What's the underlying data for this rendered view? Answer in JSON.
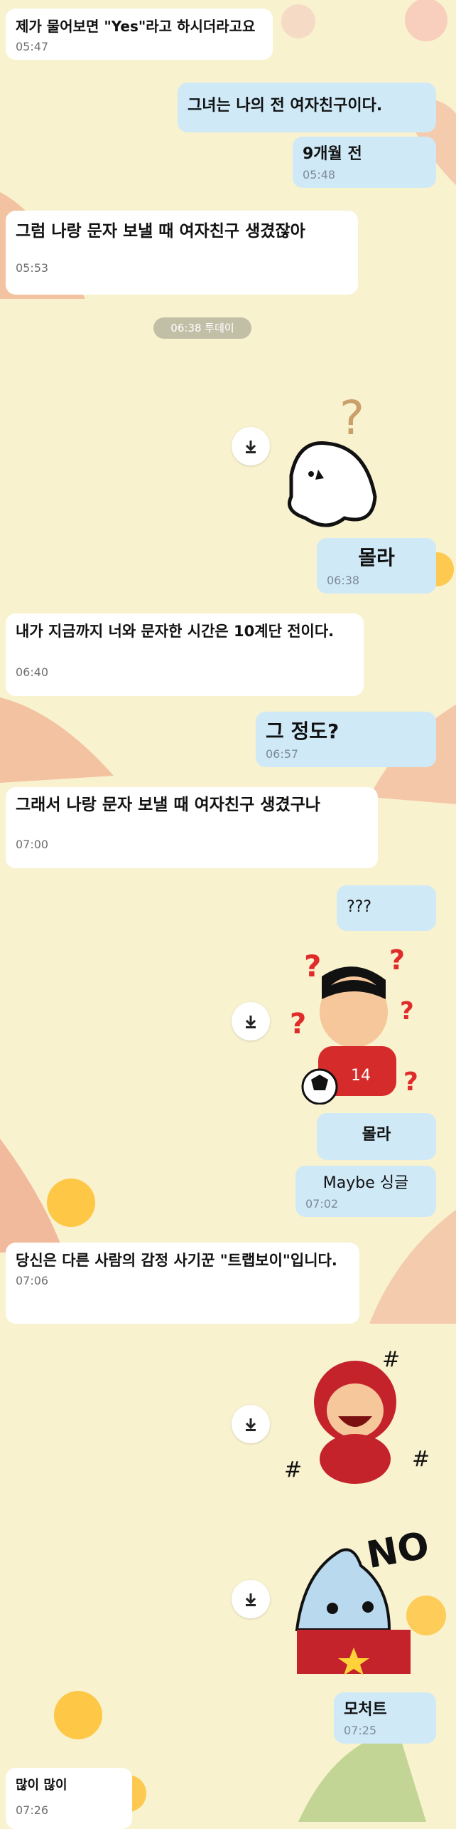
{
  "messages": [
    {
      "text": "제가 물어보면 \"Yes\"라고 하시더라고요",
      "time": "05:47",
      "side": "in"
    },
    {
      "text": "그녀는 나의 전 여자친구이다.",
      "time": "",
      "side": "out"
    },
    {
      "text": "9개월 전",
      "time": "05:48",
      "side": "out"
    },
    {
      "text": "그럼 나랑 문자 보낼 때 여자친구 생겼잖아",
      "time": "05:53",
      "side": "in"
    },
    {
      "text": "몰라",
      "time": "06:38",
      "side": "out"
    },
    {
      "text": "내가 지금까지 너와 문자한 시간은 10계단 전이다.",
      "time": "06:40",
      "side": "in"
    },
    {
      "text": "그 정도?",
      "time": "06:57",
      "side": "out"
    },
    {
      "text": "그래서 나랑 문자 보낼 때 여자친구 생겼구나",
      "time": "07:00",
      "side": "in"
    },
    {
      "text": "???",
      "time": "",
      "side": "out"
    },
    {
      "text": "몰라",
      "time": "",
      "side": "out"
    },
    {
      "text": "Maybe 싱글",
      "time": "07:02",
      "side": "out"
    },
    {
      "text": "당신은 다른 사람의 감정 사기꾼 \"트랩보이\"입니다.",
      "time": "07:06",
      "side": "in"
    },
    {
      "text": "모처트",
      "time": "07:25",
      "side": "out"
    },
    {
      "text": "많이 많이",
      "time": "07:26",
      "side": "in"
    }
  ],
  "date_divider": "06:38 투데이",
  "stickers": [
    {
      "name": "ghost-sticker",
      "icon": "ghost-with-question-mark"
    },
    {
      "name": "boy-sticker",
      "icon": "confused-boy-football-14",
      "jersey": "14"
    },
    {
      "name": "laughing-sticker",
      "icon": "laughing-red-hood-character"
    },
    {
      "name": "shark-sticker",
      "icon": "shark-no",
      "caption": "NO"
    }
  ],
  "colors": {
    "background": "#f8f2cf",
    "incoming_bubble": "#ffffff",
    "outgoing_bubble": "#cfe9f7",
    "time_text": "#7d8a96"
  }
}
